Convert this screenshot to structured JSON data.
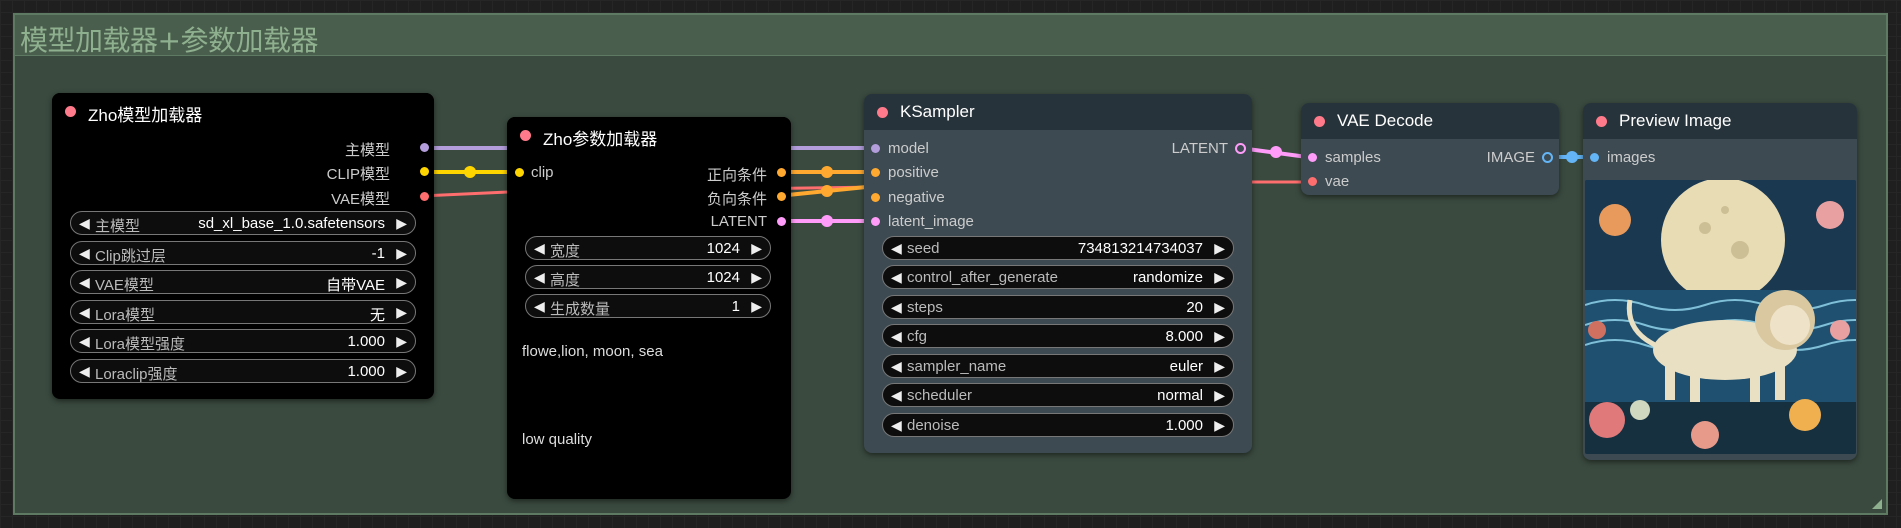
{
  "group": {
    "title": "模型加载器+参数加载器"
  },
  "model_loader": {
    "title": "Zho模型加载器",
    "outputs": [
      "主模型",
      "CLIP模型",
      "VAE模型"
    ],
    "widgets": [
      {
        "label": "主模型",
        "value": "sd_xl_base_1.0.safetensors"
      },
      {
        "label": "Clip跳过层",
        "value": "-1"
      },
      {
        "label": "VAE模型",
        "value": "自带VAE"
      },
      {
        "label": "Lora模型",
        "value": "无"
      },
      {
        "label": "Lora模型强度",
        "value": "1.000"
      },
      {
        "label": "Loraclip强度",
        "value": "1.000"
      }
    ]
  },
  "param_loader": {
    "title": "Zho参数加载器",
    "input": "clip",
    "outputs": [
      "正向条件",
      "负向条件",
      "LATENT"
    ],
    "widgets": [
      {
        "label": "宽度",
        "value": "1024"
      },
      {
        "label": "高度",
        "value": "1024"
      },
      {
        "label": "生成数量",
        "value": "1"
      }
    ],
    "positive_prompt": "flowe,lion, moon, sea",
    "negative_prompt": "low quality"
  },
  "ksampler": {
    "title": "KSampler",
    "inputs": [
      "model",
      "positive",
      "negative",
      "latent_image"
    ],
    "output": "LATENT",
    "widgets": [
      {
        "label": "seed",
        "value": "734813214734037"
      },
      {
        "label": "control_after_generate",
        "value": "randomize"
      },
      {
        "label": "steps",
        "value": "20"
      },
      {
        "label": "cfg",
        "value": "8.000"
      },
      {
        "label": "sampler_name",
        "value": "euler"
      },
      {
        "label": "scheduler",
        "value": "normal"
      },
      {
        "label": "denoise",
        "value": "1.000"
      }
    ]
  },
  "vae_decode": {
    "title": "VAE Decode",
    "inputs": [
      "samples",
      "vae"
    ],
    "output": "IMAGE"
  },
  "preview_image": {
    "title": "Preview Image",
    "input": "images"
  },
  "colors": {
    "model": "#b39ddb",
    "clip": "#ffd500",
    "vae": "#ff6e6e",
    "conditioning": "#ffa931",
    "latent": "#ff9cf9",
    "image": "#64b5f6",
    "group_bg": "#3a4a3f",
    "node_gray": "#3d4a52"
  }
}
